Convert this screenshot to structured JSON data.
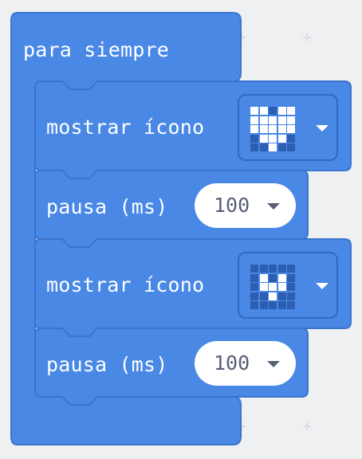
{
  "forever_block": {
    "label": "para siempre",
    "color": "#4c97ff"
  },
  "blocks": [
    {
      "type": "show_icon",
      "label": "mostrar ícono",
      "icon": "large-heart",
      "leds": [
        [
          1,
          1,
          0,
          1,
          1
        ],
        [
          1,
          1,
          1,
          1,
          1
        ],
        [
          1,
          1,
          1,
          1,
          1
        ],
        [
          0,
          1,
          1,
          1,
          0
        ],
        [
          0,
          0,
          1,
          0,
          0
        ]
      ]
    },
    {
      "type": "pause",
      "label": "pausa (ms)",
      "value": "100"
    },
    {
      "type": "show_icon",
      "label": "mostrar ícono",
      "icon": "small-heart",
      "leds": [
        [
          0,
          0,
          0,
          0,
          0
        ],
        [
          0,
          1,
          0,
          1,
          0
        ],
        [
          0,
          1,
          1,
          1,
          0
        ],
        [
          0,
          0,
          1,
          0,
          0
        ],
        [
          0,
          0,
          0,
          0,
          0
        ]
      ]
    },
    {
      "type": "pause",
      "label": "pausa (ms)",
      "value": "100"
    }
  ],
  "colors": {
    "block_fill": "#4c97ff",
    "block_stroke": "#3373cc",
    "workspace": "#eef0f1"
  }
}
